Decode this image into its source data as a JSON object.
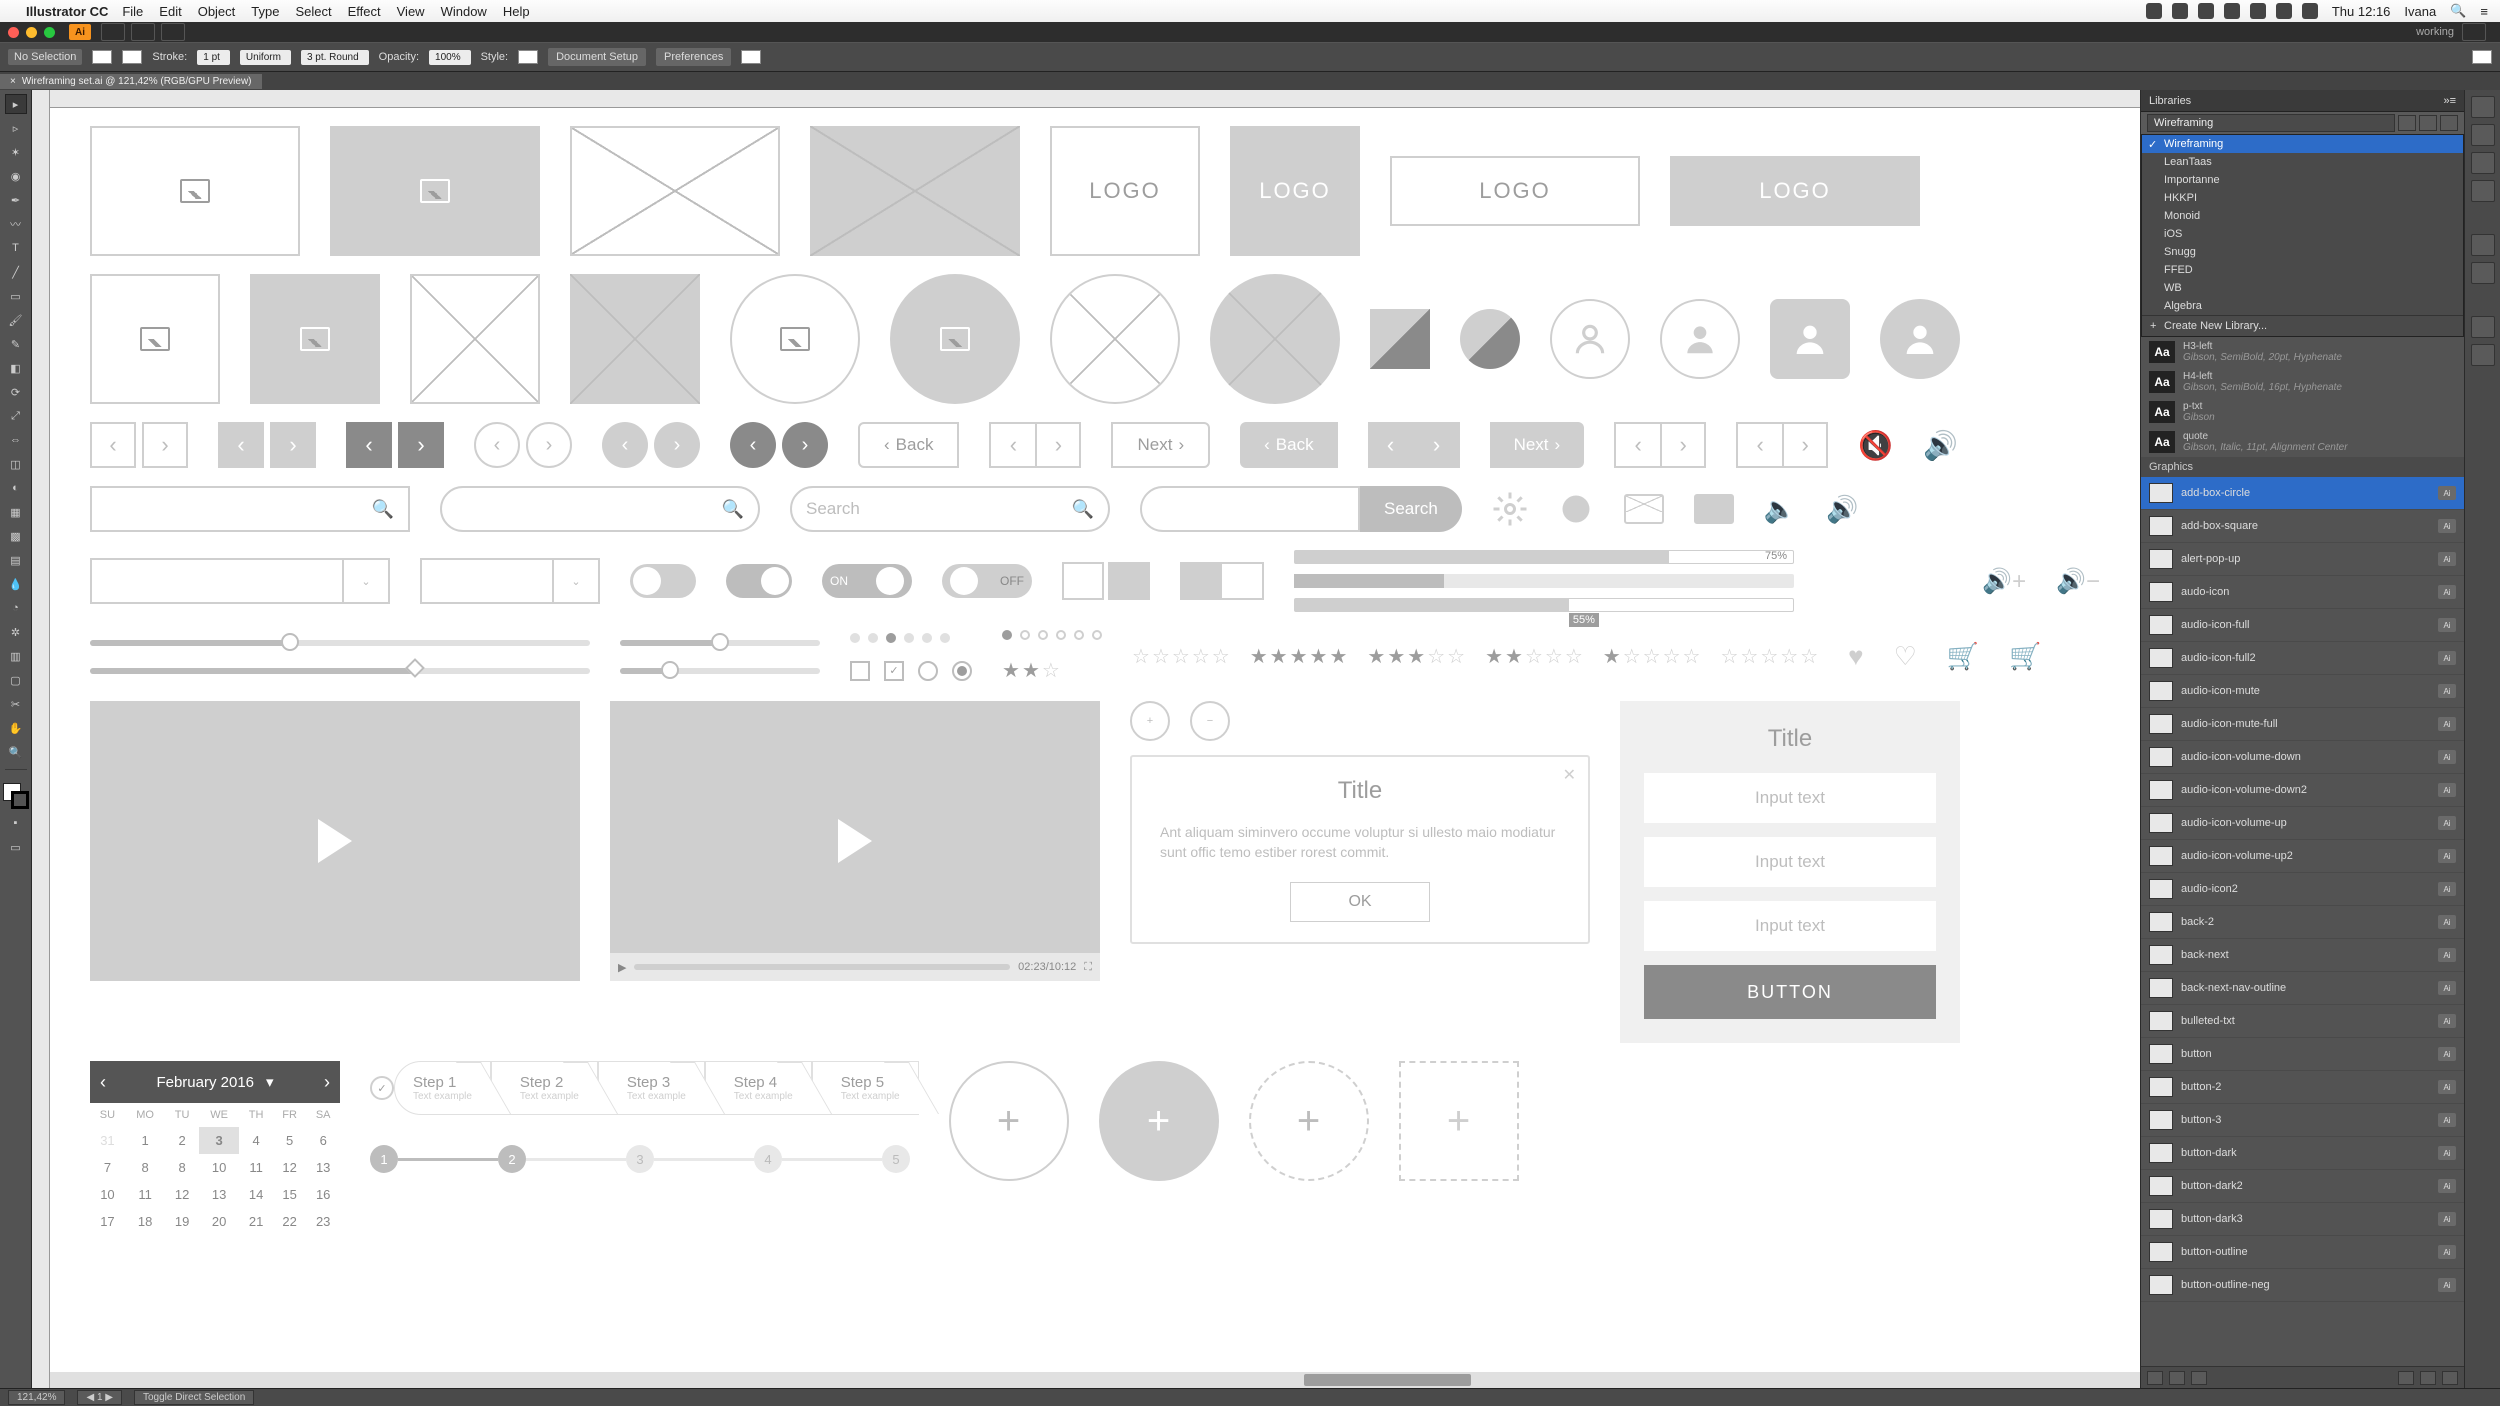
{
  "menubar": {
    "app": "Illustrator CC",
    "items": [
      "File",
      "Edit",
      "Object",
      "Type",
      "Select",
      "Effect",
      "View",
      "Window",
      "Help"
    ],
    "clock": "Thu 12:16",
    "user": "Ivana"
  },
  "chrome": {
    "ai": "Ai",
    "workspace": "working"
  },
  "ctrlbar": {
    "noSelection": "No Selection",
    "stroke": "Stroke:",
    "strokeWeight": "1 pt",
    "strokeStyle": "Uniform",
    "brush": "3 pt. Round",
    "opacity": "Opacity:",
    "opacityVal": "100%",
    "style": "Style:",
    "docSetup": "Document Setup",
    "prefs": "Preferences"
  },
  "docTab": "Wireframing set.ai @ 121,42% (RGB/GPU Preview)",
  "wf": {
    "logo": "LOGO",
    "back": "Back",
    "next": "Next",
    "searchPH": "Search",
    "searchBtn": "Search",
    "on": "ON",
    "off": "OFF",
    "prog75": "75%",
    "prog55": "55%",
    "videoTime": "02:23/10:12",
    "dialogTitle": "Title",
    "dialogBody": "Ant aliquam siminvero occume voluptur si ullesto maio modiatur sunt offic temo estiber rorest commit.",
    "ok": "OK",
    "formTitle": "Title",
    "inputPH": "Input text",
    "button": "BUTTON",
    "calMonth": "February 2016",
    "dow": [
      "SU",
      "MO",
      "TU",
      "WE",
      "TH",
      "FR",
      "SA"
    ],
    "steps": [
      {
        "t": "Step 1",
        "s": "Text example"
      },
      {
        "t": "Step 2",
        "s": "Text example"
      },
      {
        "t": "Step 3",
        "s": "Text example"
      },
      {
        "t": "Step 4",
        "s": "Text example"
      },
      {
        "t": "Step 5",
        "s": "Text example"
      }
    ]
  },
  "libraries": {
    "title": "Libraries",
    "current": "Wireframing",
    "list": [
      "Wireframing",
      "LeanTaas",
      "Importanne",
      "HKKPI",
      "Monoid",
      "iOS",
      "Snugg",
      "FFED",
      "WB",
      "Algebra"
    ],
    "create": "Create New Library...",
    "charStyles": [
      {
        "n": "H3-left",
        "m": "Gibson, SemiBold, 20pt, Hyphenate"
      },
      {
        "n": "H4-left",
        "m": "Gibson, SemiBold, 16pt, Hyphenate"
      },
      {
        "n": "p-txt",
        "m": "Gibson"
      },
      {
        "n": "quote",
        "m": "Gibson, Italic, 11pt, Alignment Center"
      }
    ],
    "graphicsLabel": "Graphics",
    "graphics": [
      "add-box-circle",
      "add-box-square",
      "alert-pop-up",
      "audo-icon",
      "audio-icon-full",
      "audio-icon-full2",
      "audio-icon-mute",
      "audio-icon-mute-full",
      "audio-icon-volume-down",
      "audio-icon-volume-down2",
      "audio-icon-volume-up",
      "audio-icon-volume-up2",
      "audio-icon2",
      "back-2",
      "back-next",
      "back-next-nav-outline",
      "bulleted-txt",
      "button",
      "button-2",
      "button-3",
      "button-dark",
      "button-dark2",
      "button-dark3",
      "button-outline",
      "button-outline-neg"
    ]
  },
  "statusbar": {
    "zoom": "121,42%",
    "hint": "Toggle Direct Selection"
  }
}
